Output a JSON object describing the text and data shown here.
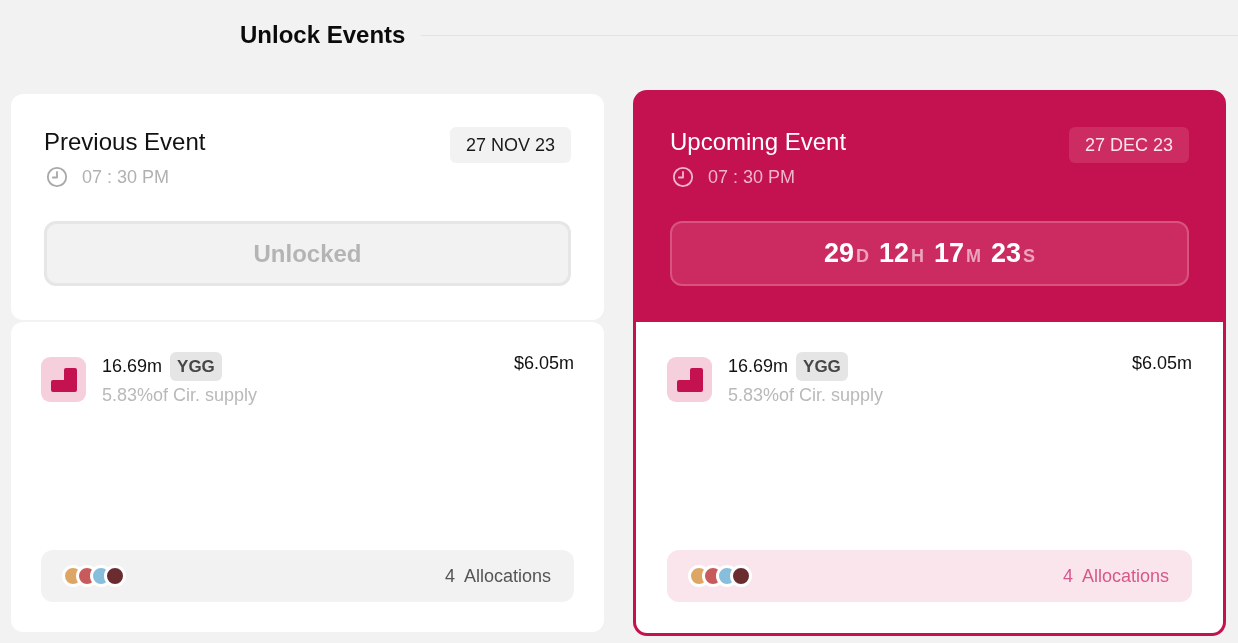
{
  "section_title": "Unlock Events",
  "events": [
    {
      "kind": "previous",
      "title": "Previous Event",
      "time": "07 : 30 PM",
      "date": "27 NOV 23",
      "status": {
        "label": "Unlocked",
        "disabled": true
      },
      "token": {
        "amount": "16.69m",
        "symbol": "YGG",
        "supply": "5.83%of Cir. supply",
        "value": "$6.05m"
      },
      "allocations": {
        "count": "4",
        "label": "Allocations",
        "dots": [
          {
            "color": "#dea665"
          },
          {
            "color": "#c95a5b"
          },
          {
            "color": "#86bedc"
          },
          {
            "color": "#6b2c30"
          }
        ]
      }
    },
    {
      "kind": "upcoming",
      "title": "Upcoming Event",
      "time": "07 : 30 PM",
      "date": "27 DEC 23",
      "countdown": [
        {
          "value": "29",
          "unit": "D"
        },
        {
          "value": "12",
          "unit": "H"
        },
        {
          "value": "17",
          "unit": "M"
        },
        {
          "value": "23",
          "unit": "S"
        }
      ],
      "token": {
        "amount": "16.69m",
        "symbol": "YGG",
        "supply": "5.83%of Cir. supply",
        "value": "$6.05m"
      },
      "allocations": {
        "count": "4",
        "label": "Allocations",
        "dots": [
          {
            "color": "#dea665"
          },
          {
            "color": "#c95a5b"
          },
          {
            "color": "#86bedc"
          },
          {
            "color": "#6b2c30"
          }
        ]
      }
    }
  ]
}
